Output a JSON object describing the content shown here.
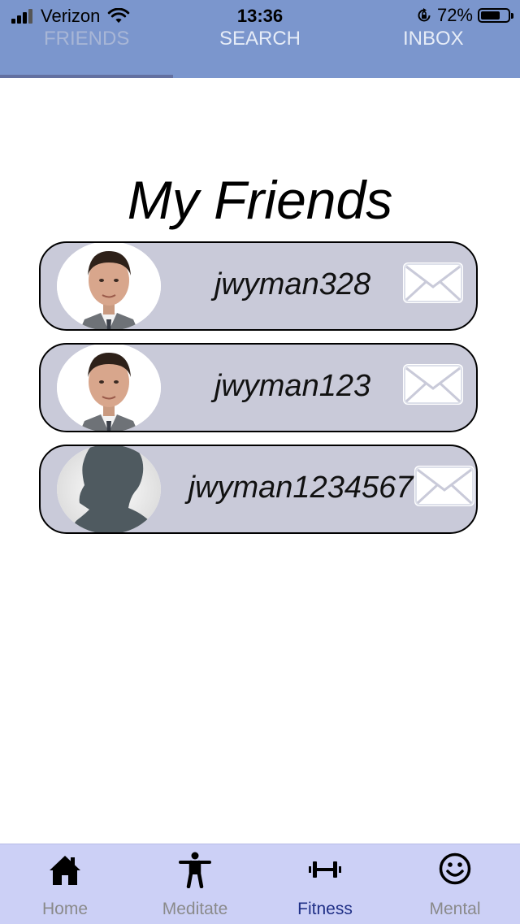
{
  "status_bar": {
    "carrier": "Verizon",
    "time": "13:36",
    "battery_percent": "72%",
    "battery_level": 0.72,
    "icons": [
      "signal-icon",
      "wifi-icon",
      "lock-rotation-icon",
      "battery-icon"
    ]
  },
  "top_tabs": [
    {
      "label": "FRIENDS",
      "active": true
    },
    {
      "label": "SEARCH",
      "active": false
    },
    {
      "label": "INBOX",
      "active": false
    }
  ],
  "main": {
    "title": "My Friends",
    "friends": [
      {
        "username": "jwyman328",
        "avatar": "person-photo",
        "icon": "mail-icon"
      },
      {
        "username": "jwyman123",
        "avatar": "person-photo",
        "icon": "mail-icon"
      },
      {
        "username": "jwyman1234567",
        "avatar": "silhouette",
        "icon": "mail-icon"
      }
    ]
  },
  "bottom_nav": [
    {
      "label": "Home",
      "icon": "home-icon",
      "active": false
    },
    {
      "label": "Meditate",
      "icon": "person-stretch-icon",
      "active": false
    },
    {
      "label": "Fitness",
      "icon": "dumbbell-icon",
      "active": true
    },
    {
      "label": "Mental",
      "icon": "smiley-icon",
      "active": false
    }
  ],
  "colors": {
    "header_bg": "#7b96cd",
    "card_bg": "#c9cad9",
    "nav_bg": "#ccd0f6",
    "nav_active": "#1f2f86",
    "tab_indicator": "#6370a0"
  }
}
